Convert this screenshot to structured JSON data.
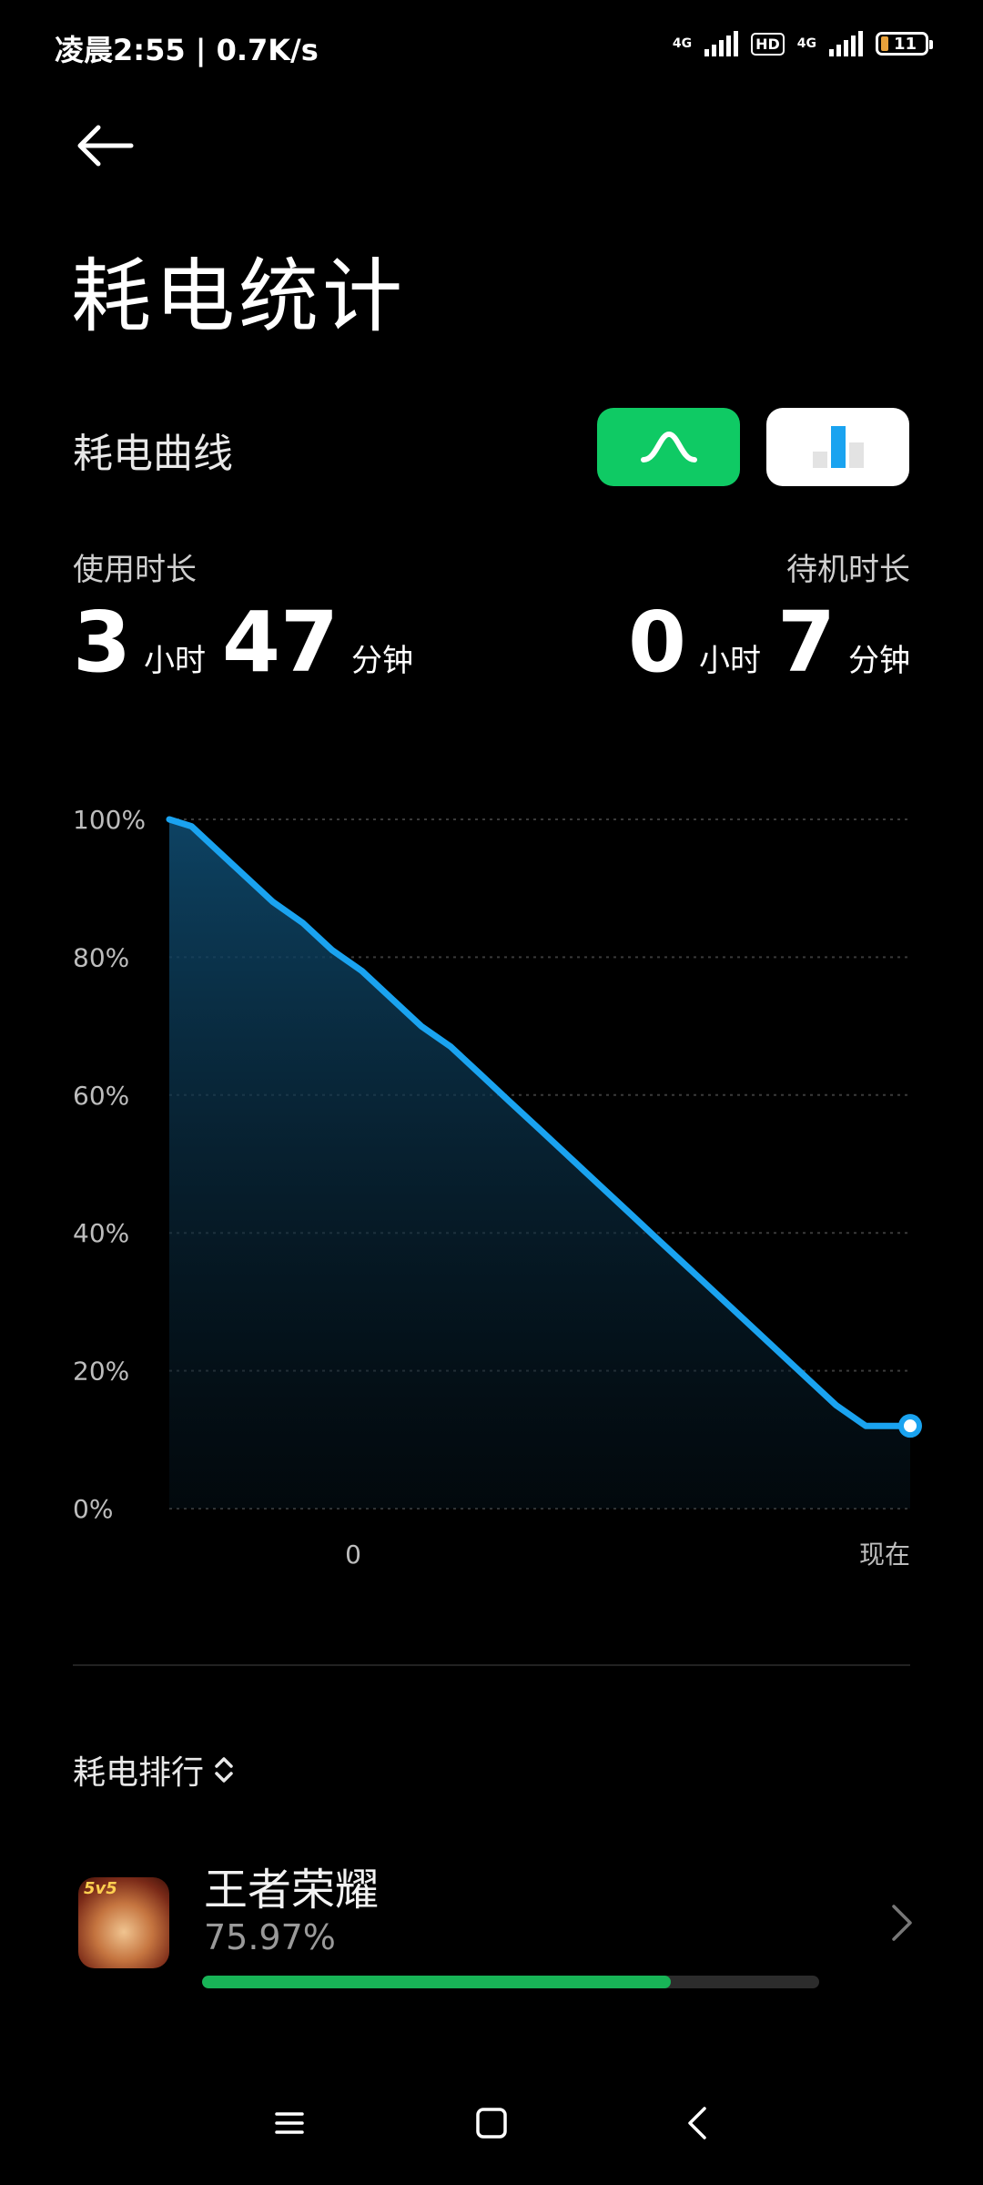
{
  "status_bar": {
    "time_speed": "凌晨2:55 | 0.7K/s",
    "net_1": "4G",
    "hd": "HD",
    "net_2": "4G",
    "battery": "11"
  },
  "header": {
    "back_icon": "arrow-left-icon",
    "title": "耗电统计"
  },
  "curve_section": {
    "title": "耗电曲线",
    "toggle_curve_icon": "curve-icon",
    "toggle_bar_icon": "bar-chart-icon",
    "active_toggle_color": "#0fca64"
  },
  "usage": {
    "label": "使用时长",
    "hours": "3",
    "hour_unit": "小时",
    "minutes": "47",
    "minute_unit": "分钟"
  },
  "standby": {
    "label": "待机时长",
    "hours": "0",
    "hour_unit": "小时",
    "minutes": "7",
    "minute_unit": "分钟"
  },
  "chart_data": {
    "type": "area",
    "y_ticks": [
      "100%",
      "80%",
      "60%",
      "40%",
      "20%",
      "0%"
    ],
    "ylim": [
      0,
      100
    ],
    "x_ticks": [
      "0",
      "现在"
    ],
    "series": [
      {
        "color": "#1aa3f0",
        "points": [
          [
            0,
            100
          ],
          [
            3,
            99
          ],
          [
            6,
            96
          ],
          [
            10,
            92
          ],
          [
            14,
            88
          ],
          [
            18,
            85
          ],
          [
            22,
            81
          ],
          [
            26,
            78
          ],
          [
            30,
            74
          ],
          [
            34,
            70
          ],
          [
            38,
            67
          ],
          [
            42,
            63
          ],
          [
            46,
            59
          ],
          [
            50,
            55
          ],
          [
            54,
            51
          ],
          [
            58,
            47
          ],
          [
            62,
            43
          ],
          [
            66,
            39
          ],
          [
            70,
            35
          ],
          [
            74,
            31
          ],
          [
            78,
            27
          ],
          [
            82,
            23
          ],
          [
            86,
            19
          ],
          [
            90,
            15
          ],
          [
            94,
            12
          ],
          [
            97,
            12
          ],
          [
            100,
            12
          ]
        ]
      }
    ]
  },
  "ranking": {
    "title": "耗电排行",
    "sort_icon": "sort-updown-icon",
    "apps": [
      {
        "name": "王者荣耀",
        "percent_text": "75.97%",
        "percent": 75.97,
        "icon": "app-icon-honor-of-kings",
        "icon_text": "5v5"
      }
    ]
  },
  "nav_bar": {
    "menu_icon": "menu-icon",
    "home_icon": "home-square-icon",
    "back_icon": "nav-back-icon"
  }
}
